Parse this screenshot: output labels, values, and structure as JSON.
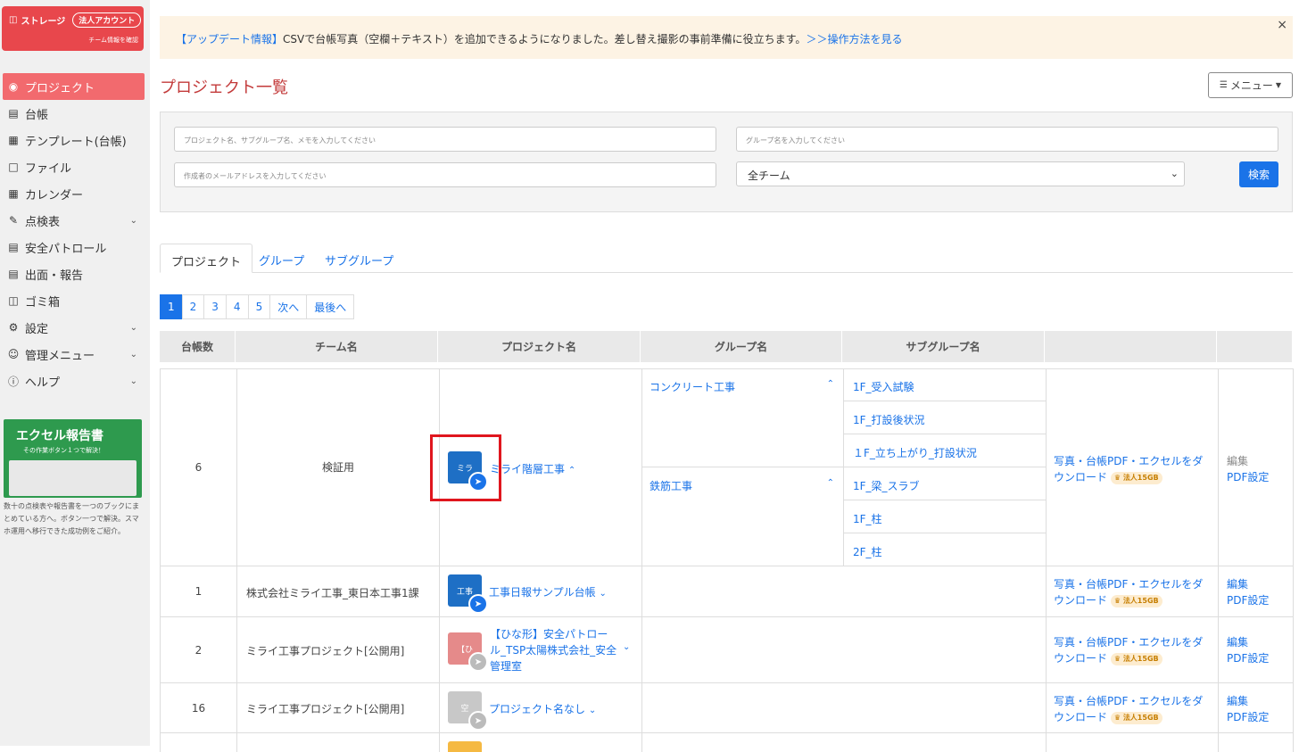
{
  "sidebar": {
    "storage_label": "ストレージ",
    "account_badge": "法人アカウント",
    "team_info_link": "チーム情報を確認",
    "items": [
      {
        "label": "プロジェクト",
        "icon": "helmet-icon",
        "active": true
      },
      {
        "label": "台帳",
        "icon": "ledger-icon"
      },
      {
        "label": "テンプレート(台帳)",
        "icon": "template-icon"
      },
      {
        "label": "ファイル",
        "icon": "file-icon"
      },
      {
        "label": "カレンダー",
        "icon": "calendar-icon"
      },
      {
        "label": "点検表",
        "icon": "checklist-icon",
        "chevron": true
      },
      {
        "label": "安全パトロール",
        "icon": "patrol-icon"
      },
      {
        "label": "出面・報告",
        "icon": "report-icon"
      },
      {
        "label": "ゴミ箱",
        "icon": "trash-icon"
      },
      {
        "label": "設定",
        "icon": "gear-icon",
        "chevron": true
      },
      {
        "label": "管理メニュー",
        "icon": "admin-icon",
        "chevron": true
      },
      {
        "label": "ヘルプ",
        "icon": "help-icon",
        "chevron": true
      }
    ],
    "promo": {
      "title": "エクセル報告書",
      "subtitle": "その作業ボタン１つで解決！",
      "description": "数十の点検表や報告書を一つのブックにまとめている方へ。ボタン一つで解決。スマホ運用へ移行できた成功例をご紹介。"
    }
  },
  "banner": {
    "tag": "【アップデート情報】",
    "text": "CSVで台帳写真（空欄＋テキスト）を追加できるようになりました。差し替え撮影の事前準備に役立ちます。",
    "link": "＞＞操作方法を見る",
    "close": "×"
  },
  "page_title": "プロジェクト一覧",
  "menu_button": "メニュー",
  "search": {
    "project_placeholder": "プロジェクト名、サブグループ名、メモを入力してください",
    "group_placeholder": "グループ名を入力してください",
    "email_placeholder": "作成者のメールアドレスを入力してください",
    "team_select": "全チーム",
    "search_button": "検索"
  },
  "tabs": [
    "プロジェクト",
    "グループ",
    "サブグループ"
  ],
  "pager": [
    "1",
    "2",
    "3",
    "4",
    "5",
    "次へ",
    "最後へ"
  ],
  "table": {
    "headers": [
      "台帳数",
      "チーム名",
      "プロジェクト名",
      "グループ名",
      "サブグループ名",
      "",
      ""
    ],
    "download_label_1": "写真・台帳PDF・エクセルをダ",
    "download_label_2": "ウンロード",
    "badge": "法人15GB",
    "edit": "編集",
    "pdf_settings": "PDF設定",
    "rows": [
      {
        "count": "6",
        "team": "検証用",
        "thumb": "ミラ",
        "project": "ミライ階層工事",
        "groups": [
          {
            "name": "コンクリート工事",
            "subgroups": [
              "1F_受入試験",
              "1F_打設後状況",
              "１F_立ち上がり_打設状況"
            ]
          },
          {
            "name": "鉄筋工事",
            "subgroups": [
              "1F_梁_スラブ",
              "1F_柱",
              "2F_柱"
            ]
          }
        ]
      },
      {
        "count": "1",
        "team": "株式会社ミライ工事_東日本工事1課",
        "thumb": "工事",
        "project": "工事日報サンプル台帳"
      },
      {
        "count": "2",
        "team": "ミライ工事プロジェクト[公開用]",
        "thumb": "【ひ",
        "project_lines": [
          "【ひな形】安全パトロー",
          "ル_TSP太陽株式会社_安全",
          "管理室"
        ]
      },
      {
        "count": "16",
        "team": "ミライ工事プロジェクト[公開用]",
        "thumb": "空",
        "project": "プロジェクト名なし"
      }
    ]
  },
  "colors": {
    "accent": "#1a73e8",
    "sidebar_active": "#f26a6e",
    "storage": "#e8474c",
    "title": "#c33a3a"
  }
}
